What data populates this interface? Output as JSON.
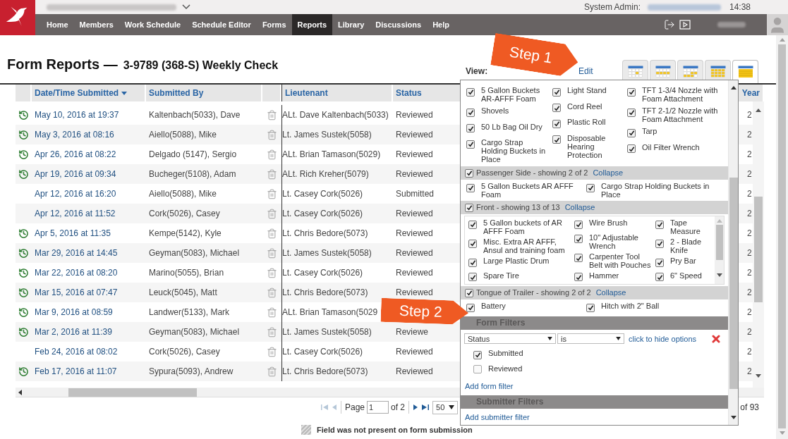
{
  "top_bar": {
    "system_admin_label": "System Admin:",
    "time": "14:38"
  },
  "nav": [
    {
      "label": "Home",
      "selected": false
    },
    {
      "label": "Members",
      "selected": false
    },
    {
      "label": "Work Schedule",
      "selected": false
    },
    {
      "label": "Schedule Editor",
      "selected": false
    },
    {
      "label": "Forms",
      "selected": false
    },
    {
      "label": "Reports",
      "selected": true
    },
    {
      "label": "Library",
      "selected": false
    },
    {
      "label": "Discussions",
      "selected": false
    },
    {
      "label": "Help",
      "selected": false
    }
  ],
  "page": {
    "title": "Form Reports —",
    "subtitle": "3-9789 (368-S) Weekly Check",
    "view_label": "View:",
    "edit_link": "Edit"
  },
  "view_tabs": [
    {
      "kind": "cell",
      "selected": false
    },
    {
      "kind": "row",
      "selected": false
    },
    {
      "kind": "blocks",
      "selected": false
    },
    {
      "kind": "grid",
      "selected": false
    },
    {
      "kind": "lines",
      "selected": true
    }
  ],
  "table": {
    "columns": [
      {
        "label": "Date/Time Submitted",
        "sorted": true
      },
      {
        "label": "Submitted By",
        "sorted": false
      },
      {
        "label": "Lieutenant",
        "sorted": false
      },
      {
        "label": "Status",
        "sorted": false
      },
      {
        "label": "Year",
        "sorted": false
      }
    ],
    "rows": [
      {
        "history": true,
        "date": "May 10, 2016 at 19:37",
        "submitted_by": "Kaltenbach(5033), Dave",
        "lieutenant": "ALt. Dave Kaltenbach(5033)",
        "status": "Reviewed",
        "year": "2"
      },
      {
        "history": true,
        "date": "May 3, 2016 at 08:16",
        "submitted_by": "Aiello(5088), Mike",
        "lieutenant": "Lt. James Sustek(5058)",
        "status": "Reviewed",
        "year": "2"
      },
      {
        "history": true,
        "date": "Apr 26, 2016 at 08:22",
        "submitted_by": "Delgado (5147), Sergio",
        "lieutenant": "ALt. Brian Tamason(5029)",
        "status": "Reviewed",
        "year": "2"
      },
      {
        "history": true,
        "date": "Apr 19, 2016 at 09:34",
        "submitted_by": "Bucheger(5108), Adam",
        "lieutenant": "ALt. Rich Kreher(5079)",
        "status": "Reviewed",
        "year": "2"
      },
      {
        "history": false,
        "date": "Apr 12, 2016 at 16:20",
        "submitted_by": "Aiello(5088), Mike",
        "lieutenant": "Lt. Casey Cork(5026)",
        "status": "Submitted",
        "year": "2"
      },
      {
        "history": false,
        "date": "Apr 12, 2016 at 11:52",
        "submitted_by": "Cork(5026), Casey",
        "lieutenant": "Lt. Casey Cork(5026)",
        "status": "Reviewed",
        "year": "2"
      },
      {
        "history": true,
        "date": "Apr 5, 2016 at 11:35",
        "submitted_by": "Kempe(5142), Kyle",
        "lieutenant": "Lt. Chris Bedore(5073)",
        "status": "Reviewed",
        "year": "2"
      },
      {
        "history": true,
        "date": "Mar 29, 2016 at 14:45",
        "submitted_by": "Geyman(5083), Michael",
        "lieutenant": "Lt. James Sustek(5058)",
        "status": "Reviewed",
        "year": "2"
      },
      {
        "history": true,
        "date": "Mar 22, 2016 at 08:20",
        "submitted_by": "Marino(5055), Brian",
        "lieutenant": "Lt. Casey Cork(5026)",
        "status": "Reviewed",
        "year": "2"
      },
      {
        "history": true,
        "date": "Mar 15, 2016 at 07:47",
        "submitted_by": "Leuck(5045), Matt",
        "lieutenant": "Lt. Chris Bedore(5073)",
        "status": "Reviewed",
        "year": "2"
      },
      {
        "history": true,
        "date": "Mar 9, 2016 at 08:59",
        "submitted_by": "Landwer(5133), Mark",
        "lieutenant": "ALt. Brian Tamason(5029",
        "year": "2"
      },
      {
        "history": true,
        "date": "Mar 2, 2016 at 11:39",
        "submitted_by": "Geyman(5083), Michael",
        "lieutenant": "Lt. James Sustek(5058)",
        "status": "Reviewe",
        "year": "2"
      },
      {
        "history": false,
        "date": "Feb 24, 2016 at 08:02",
        "submitted_by": "Cork(5026), Casey",
        "lieutenant": "Lt. Casey Cork(5026)",
        "status": "Reviewed",
        "year": "2"
      },
      {
        "history": true,
        "date": "Feb 17, 2016 at 11:07",
        "submitted_by": "Sypura(5093), Andrew",
        "lieutenant": "Lt. Chris Bedore(5073)",
        "status": "Reviewed",
        "year": "2"
      }
    ]
  },
  "pager": {
    "page_label": "Page",
    "page_value": "1",
    "page_count": "of 2",
    "per_page": "50",
    "total": "of 93"
  },
  "legend": "Field was not present on form submission",
  "popup": {
    "groups": [
      {
        "columns": [
          [
            {
              "label": "5 Gallon Buckets AR-AFFF Foam",
              "checked": true
            },
            {
              "label": "Shovels",
              "checked": true
            },
            {
              "label": "50 Lb Bag Oil Dry",
              "checked": true
            },
            {
              "label": "Cargo Strap Holding Buckets in Place",
              "checked": true
            }
          ],
          [
            {
              "label": "Light Stand",
              "checked": true
            },
            {
              "label": "Cord Reel",
              "checked": true
            },
            {
              "label": "Plastic Roll",
              "checked": true
            },
            {
              "label": "Disposable Hearing Protection",
              "checked": true
            }
          ],
          [
            {
              "label": "TFT 1-3/4 Nozzle with Foam Attachment",
              "checked": true
            },
            {
              "label": "TFT 2-1/2 Nozzle with Foam Attachment",
              "checked": true
            },
            {
              "label": "Tarp",
              "checked": true
            },
            {
              "label": "Oil Filter Wrench",
              "checked": true
            }
          ]
        ]
      },
      {
        "title": "Passenger Side - showing 2 of 2",
        "checked": true,
        "collapse": "Collapse",
        "columns": [
          [
            {
              "label": "5 Gallon Buckets AR AFFF Foam",
              "checked": true
            }
          ],
          [
            {
              "label": "Cargo Strap Holding Buckets in Place",
              "checked": true
            }
          ]
        ]
      },
      {
        "title": "Front - showing 13 of 13",
        "checked": true,
        "collapse": "Collapse",
        "scroll_box": true,
        "columns": [
          [
            {
              "label": "5 Gallon buckets of AR AFFF Foam",
              "checked": true
            },
            {
              "label": "Misc. Extra AR AFFF, Ansul and training foam",
              "checked": true
            },
            {
              "label": "Large Plastic Drum",
              "checked": true
            },
            {
              "label": "Spare Tire",
              "checked": true
            }
          ],
          [
            {
              "label": "Wire Brush",
              "checked": true
            },
            {
              "label": "10\" Adjustable Wrench",
              "checked": true
            },
            {
              "label": "Carpenter Tool Belt with Pouches",
              "checked": true
            },
            {
              "label": "Hammer",
              "checked": true
            }
          ],
          [
            {
              "label": "Tape Measure",
              "checked": true
            },
            {
              "label": "2 - Blade Knife",
              "checked": true
            },
            {
              "label": "Pry Bar",
              "checked": true
            },
            {
              "label": "6\" Speed",
              "checked": true
            }
          ]
        ]
      },
      {
        "title": "Tongue of Trailer - showing 2 of 2",
        "checked": true,
        "collapse": "Collapse",
        "columns": [
          [
            {
              "label": "Battery",
              "checked": true
            }
          ],
          [
            {
              "label": "Hitch with 2\" Ball",
              "checked": true
            }
          ]
        ]
      }
    ],
    "form_filters": {
      "title": "Form Filters",
      "filters": [
        {
          "field": "Status",
          "operator": "is",
          "toggle_link": "click to hide options",
          "options": [
            {
              "label": "Submitted",
              "checked": true
            },
            {
              "label": "Reviewed",
              "checked": false
            }
          ]
        }
      ],
      "add_link": "Add form filter"
    },
    "submitter_filters": {
      "title": "Submitter Filters",
      "add_link": "Add submitter filter"
    }
  },
  "callouts": [
    {
      "text": "Step 1"
    },
    {
      "text": "Step 2"
    }
  ]
}
